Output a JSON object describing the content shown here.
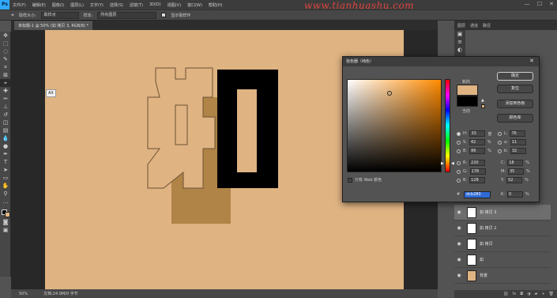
{
  "menubar": {
    "logo": "Ps",
    "items": [
      "文件(F)",
      "编辑(E)",
      "图像(I)",
      "图层(L)",
      "文字(Y)",
      "选择(S)",
      "滤镜(T)",
      "3D(D)",
      "视图(V)",
      "窗口(W)",
      "帮助(H)"
    ],
    "watermark": "www.tianhuashu.com"
  },
  "optionsbar": {
    "sample_label": "取样大小:",
    "sample_value": "取样点",
    "source_label": "样本:",
    "source_value": "所有图层",
    "show_ring_label": "显示取样环"
  },
  "document": {
    "tab_title": "未标题-1 @ 50% (如 拷贝 3, RGB/8) *",
    "zoom": "50%",
    "doc_info": "文档:24.9M/0 字节",
    "canvas_text_char": "如",
    "canvas_text_char2": "D",
    "tooltip": "Alt"
  },
  "color_picker": {
    "title": "拾色器（纯色）",
    "new_label": "新的",
    "current_label": "当前",
    "ok": "确定",
    "reset": "复位",
    "add_swatch": "添加到色板",
    "libraries": "颜色库",
    "web_only": "只有 Web 颜色",
    "fields": {
      "H": "33",
      "S": "42",
      "B": "86",
      "R": "220",
      "G": "178",
      "Bv": "128",
      "L": "76",
      "a": "11",
      "b": "32",
      "C": "18",
      "M": "35",
      "Y": "52",
      "K": "0"
    },
    "units": {
      "deg": "度",
      "pct": "%"
    },
    "hex": "dcb280",
    "new_color": "#dfb382",
    "current_color": "#000000"
  },
  "panels": {
    "tabs": [
      "图层",
      "通道",
      "路径"
    ],
    "layers": [
      {
        "name": "如 拷贝 3",
        "selected": true
      },
      {
        "name": "如 拷贝 2",
        "selected": false
      },
      {
        "name": "如 拷贝",
        "selected": false
      },
      {
        "name": "如",
        "selected": false
      },
      {
        "name": "背景",
        "selected": false
      }
    ]
  }
}
